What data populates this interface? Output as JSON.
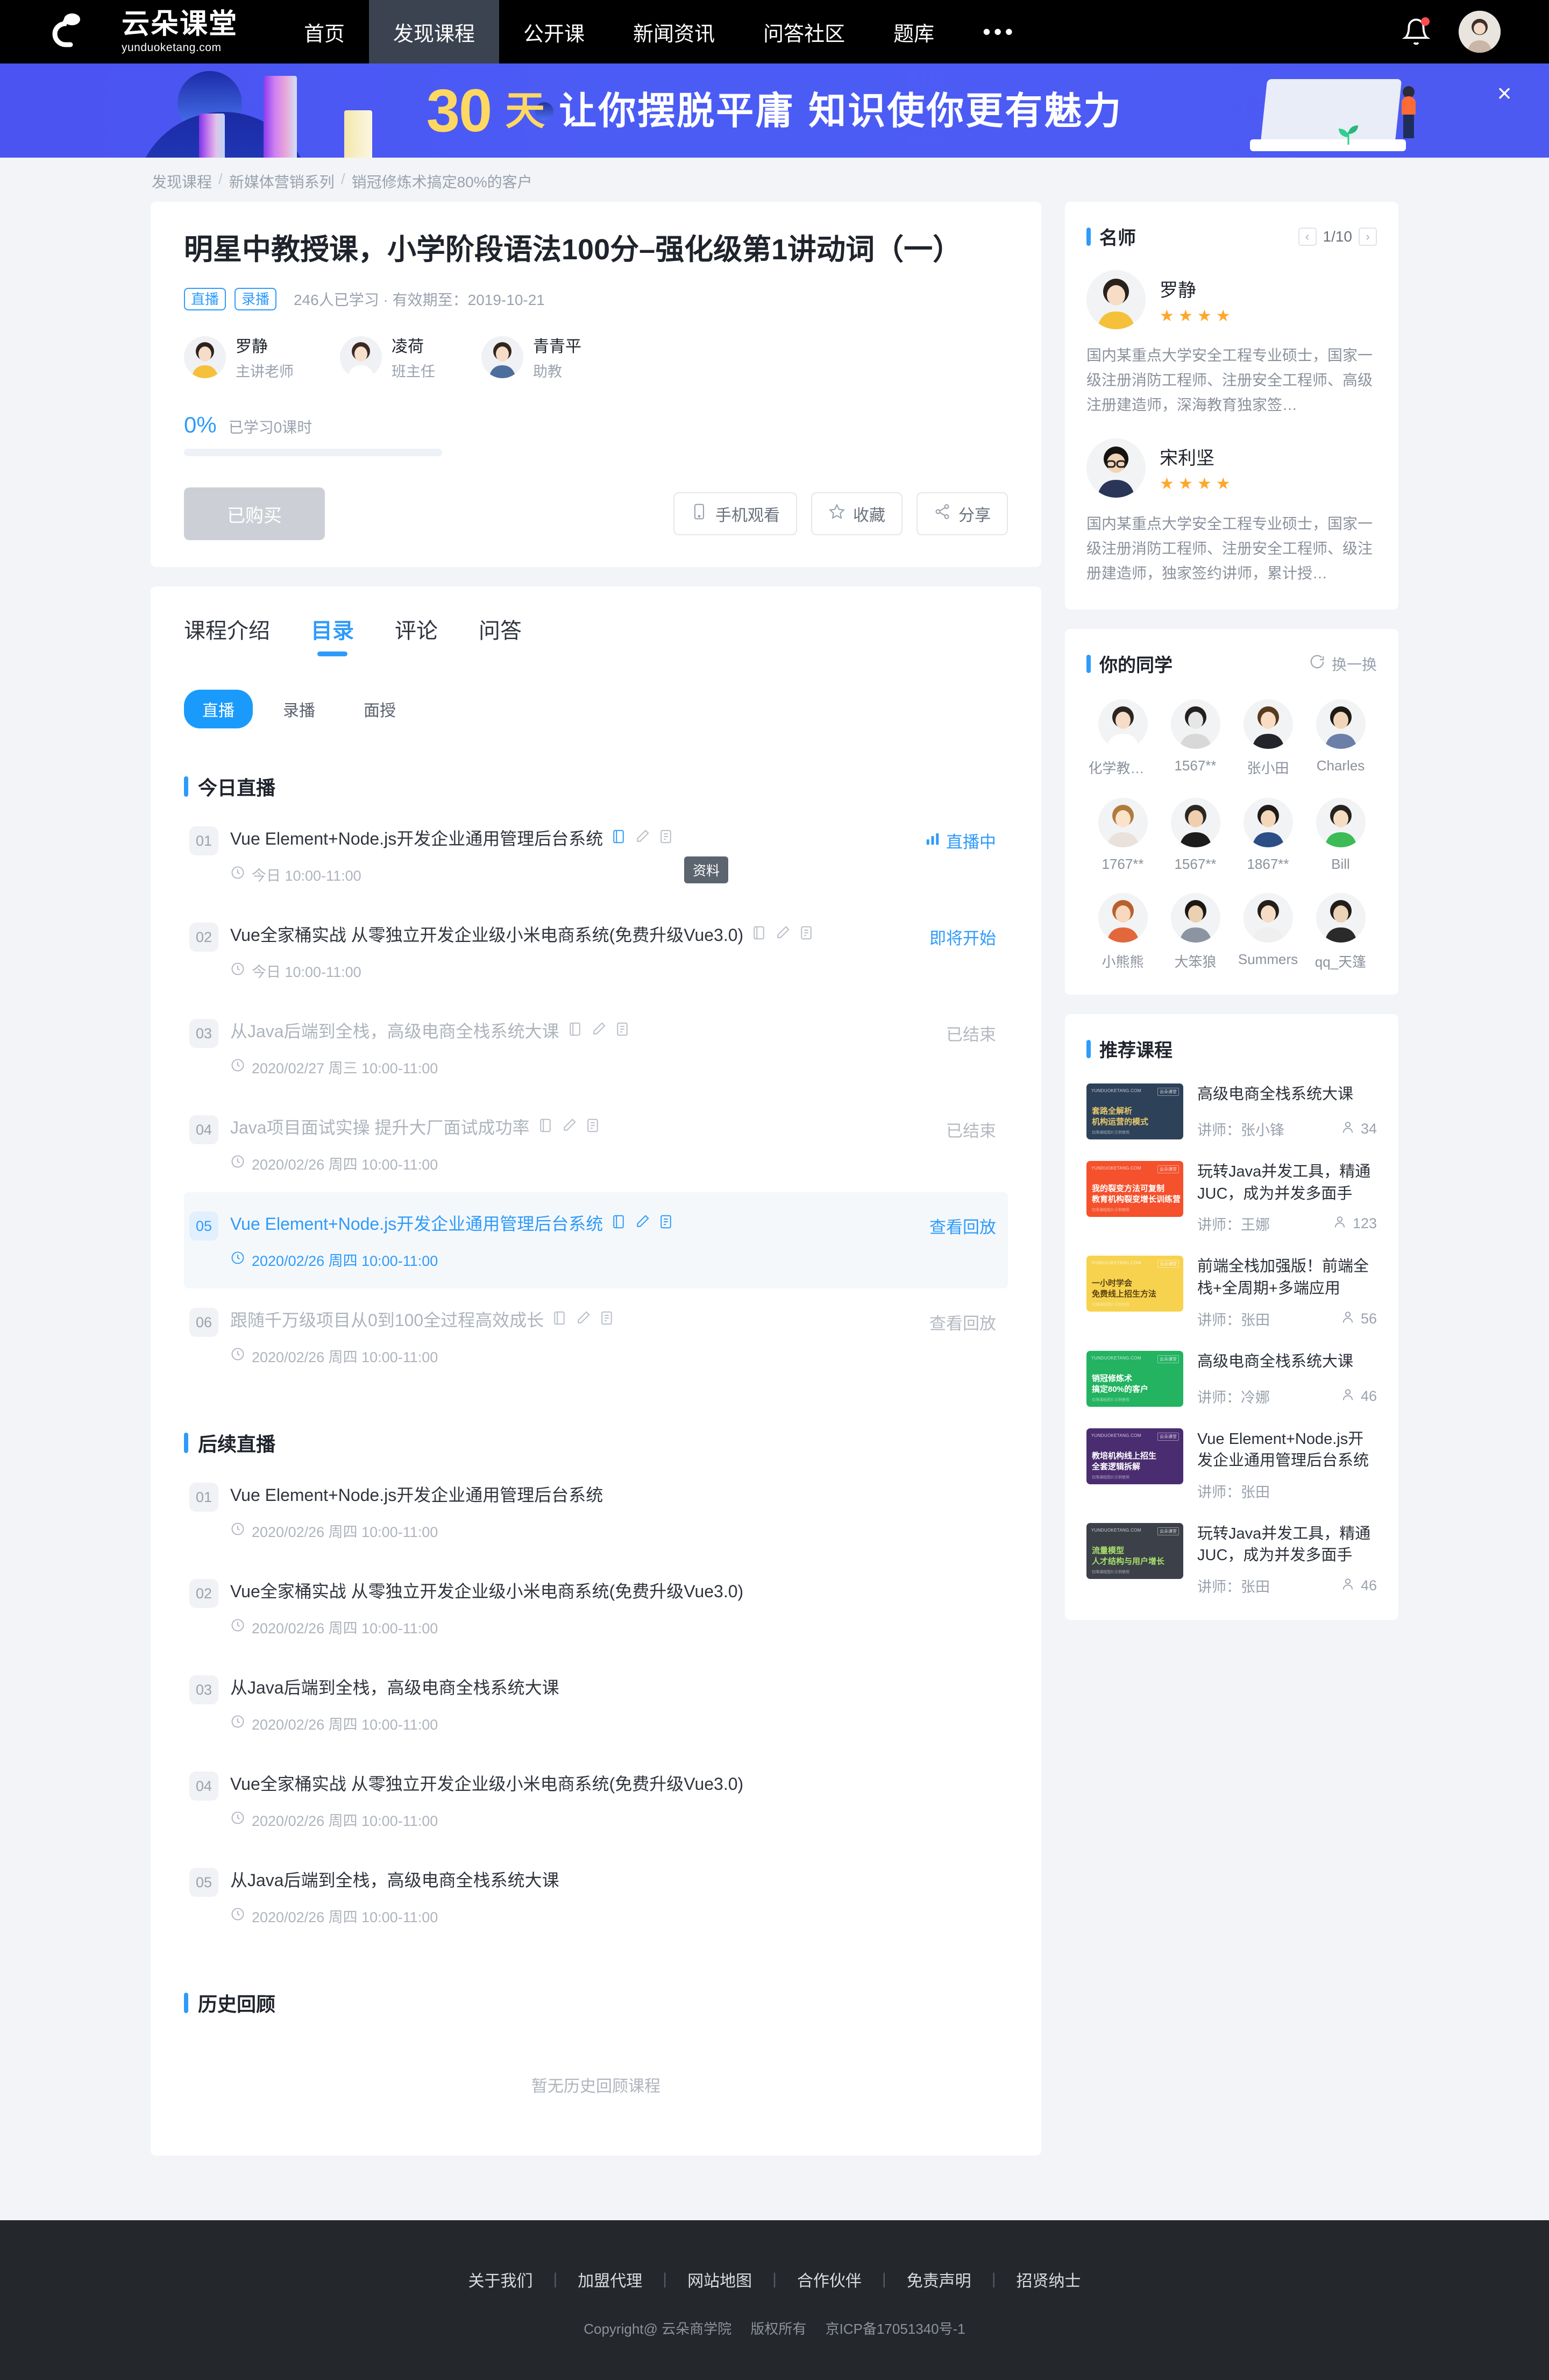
{
  "header": {
    "logo_cn": "云朵课堂",
    "logo_en": "yunduoketang.com",
    "nav": [
      {
        "label": "首页",
        "active": false
      },
      {
        "label": "发现课程",
        "active": true
      },
      {
        "label": "公开课",
        "active": false
      },
      {
        "label": "新闻资讯",
        "active": false
      },
      {
        "label": "问答社区",
        "active": false
      },
      {
        "label": "题库",
        "active": false
      }
    ],
    "more": "•••"
  },
  "banner": {
    "days": "30天",
    "days_num": "30",
    "days_unit": "天",
    "line1": "让你摆脱平庸",
    "line2": "知识使你更有魅力",
    "close": "×"
  },
  "breadcrumb": {
    "items": [
      "发现课程",
      "新媒体营销系列",
      "销冠修炼术搞定80%的客户"
    ],
    "separator": "/"
  },
  "course": {
    "title": "明星中教授课，小学阶段语法100分–强化级第1讲动词（一）",
    "tags": [
      "直播",
      "录播"
    ],
    "meta": "246人已学习 · 有效期至：2019-10-21",
    "teachers": [
      {
        "name": "罗静",
        "role": "主讲老师"
      },
      {
        "name": "凌荷",
        "role": "班主任"
      },
      {
        "name": "青青平",
        "role": "助教"
      }
    ],
    "progress_pct": "0%",
    "progress_label": "已学习0课时",
    "progress_value": 0,
    "buy_button": "已购买",
    "actions": [
      {
        "label": "手机观看",
        "icon": "phone-icon"
      },
      {
        "label": "收藏",
        "icon": "star-icon"
      },
      {
        "label": "分享",
        "icon": "share-icon"
      }
    ]
  },
  "tabs": [
    {
      "label": "课程介绍",
      "active": false
    },
    {
      "label": "目录",
      "active": true
    },
    {
      "label": "评论",
      "active": false
    },
    {
      "label": "问答",
      "active": false
    }
  ],
  "pills": [
    {
      "label": "直播",
      "active": true
    },
    {
      "label": "录播",
      "active": false
    },
    {
      "label": "面授",
      "active": false
    }
  ],
  "today_live": {
    "title": "今日直播",
    "tooltip": "资料",
    "lessons": [
      {
        "num": "01",
        "name": "Vue Element+Node.js开发企业通用管理后台系统",
        "time": "今日 10:00-11:00",
        "status": "直播中",
        "status_type": "live",
        "state": "normal",
        "icons": true
      },
      {
        "num": "02",
        "name": "Vue全家桶实战 从零独立开发企业级小米电商系统(免费升级Vue3.0)",
        "time": "今日 10:00-11:00",
        "status": "即将开始",
        "status_type": "soon",
        "state": "normal",
        "icons": true
      },
      {
        "num": "03",
        "name": "从Java后端到全栈，高级电商全栈系统大课",
        "time": "2020/02/27 周三 10:00-11:00",
        "status": "已结束",
        "status_type": "end",
        "state": "dim",
        "icons": true
      },
      {
        "num": "04",
        "name": "Java项目面试实操 提升大厂面试成功率",
        "time": "2020/02/26 周四 10:00-11:00",
        "status": "已结束",
        "status_type": "end",
        "state": "dim",
        "icons": true
      },
      {
        "num": "05",
        "name": "Vue Element+Node.js开发企业通用管理后台系统",
        "time": "2020/02/26 周四 10:00-11:00",
        "status": "查看回放",
        "status_type": "replay",
        "state": "hl",
        "icons": true
      },
      {
        "num": "06",
        "name": "跟随千万级项目从0到100全过程高效成长",
        "time": "2020/02/26 周四 10:00-11:00",
        "status": "查看回放",
        "status_type": "replay-dim",
        "state": "dim",
        "icons": true
      }
    ]
  },
  "upcoming_live": {
    "title": "后续直播",
    "lessons": [
      {
        "num": "01",
        "name": "Vue Element+Node.js开发企业通用管理后台系统",
        "time": "2020/02/26 周四 10:00-11:00"
      },
      {
        "num": "02",
        "name": "Vue全家桶实战 从零独立开发企业级小米电商系统(免费升级Vue3.0)",
        "time": "2020/02/26 周四 10:00-11:00"
      },
      {
        "num": "03",
        "name": "从Java后端到全栈，高级电商全栈系统大课",
        "time": "2020/02/26 周四 10:00-11:00"
      },
      {
        "num": "04",
        "name": "Vue全家桶实战 从零独立开发企业级小米电商系统(免费升级Vue3.0)",
        "time": "2020/02/26 周四 10:00-11:00"
      },
      {
        "num": "05",
        "name": "从Java后端到全栈，高级电商全栈系统大课",
        "time": "2020/02/26 周四 10:00-11:00"
      }
    ]
  },
  "history": {
    "title": "历史回顾",
    "empty": "暂无历史回顾课程"
  },
  "sidebar": {
    "famous_teachers": {
      "title": "名师",
      "page": "1/10",
      "prev": "‹",
      "next": "›",
      "items": [
        {
          "name": "罗静",
          "stars": 4,
          "desc": "国内某重点大学安全工程专业硕士，国家一级注册消防工程师、注册安全工程师、高级注册建造师，深海教育独家签…"
        },
        {
          "name": "宋利坚",
          "stars": 4,
          "desc": "国内某重点大学安全工程专业硕士，国家一级注册消防工程师、注册安全工程师、级注册建造师，独家签约讲师，累计授…"
        }
      ]
    },
    "classmates": {
      "title": "你的同学",
      "refresh": "换一换",
      "items": [
        {
          "name": "化学教书…"
        },
        {
          "name": "1567**"
        },
        {
          "name": "张小田"
        },
        {
          "name": "Charles"
        },
        {
          "name": "1767**"
        },
        {
          "name": "1567**"
        },
        {
          "name": "1867**"
        },
        {
          "name": "Bill"
        },
        {
          "name": "小熊熊"
        },
        {
          "name": "大笨狼"
        },
        {
          "name": "Summers"
        },
        {
          "name": "qq_天篷"
        }
      ]
    },
    "recommended": {
      "title": "推荐课程",
      "teacher_prefix": "讲师：",
      "items": [
        {
          "title": "高级电商全栈系统大课",
          "teacher": "讲师：张小锋",
          "count": "34",
          "thumb_color": "#2d4159",
          "thumb_accent": "#e8c86a",
          "thumb_l1": "套路全解析",
          "thumb_l2": "机构运营的模式",
          "thumb_brand": "YUNDUOKETANG.COM",
          "thumb_badge": "云朵课堂",
          "thumb_foot": "仅限课程图片示例使用"
        },
        {
          "title": "玩转Java并发工具，精通JUC，成为并发多面手",
          "teacher": "讲师：王娜",
          "count": "123",
          "thumb_color": "#f4512c",
          "thumb_accent": "#ffffff",
          "thumb_l1": "我的裂变方法可复制",
          "thumb_l2": "教育机构裂变增长训练营",
          "thumb_brand": "YUNDUOKETANG.COM",
          "thumb_badge": "云朵课堂",
          "thumb_foot": "仅限课程图片示例使用"
        },
        {
          "title": "前端全栈加强版！前端全栈+全周期+多端应用",
          "teacher": "讲师：张田",
          "count": "56",
          "thumb_color": "#f7d24e",
          "thumb_accent": "#5a4313",
          "thumb_l1": "一小时学会",
          "thumb_l2": "免费线上招生方法",
          "thumb_brand": "YUNDUOKETANG.COM",
          "thumb_badge": "云朵课堂",
          "thumb_foot": "仅限课程图片示例使用"
        },
        {
          "title": "高级电商全栈系统大课",
          "teacher": "讲师：冷娜",
          "count": "46",
          "thumb_color": "#23b361",
          "thumb_accent": "#ffffff",
          "thumb_l1": "销冠修炼术",
          "thumb_l2": "搞定80%的客户",
          "thumb_brand": "YUNDUOKETANG.COM",
          "thumb_badge": "云朵课堂",
          "thumb_foot": "仅限课程图片示例使用"
        },
        {
          "title": "Vue Element+Node.js开发企业通用管理后台系统",
          "teacher": "讲师：张田",
          "count": "",
          "thumb_color": "#4a2d70",
          "thumb_accent": "#ffffff",
          "thumb_l1": "教培机构线上招生",
          "thumb_l2": "全套逻辑拆解",
          "thumb_brand": "YUNDUOKETANG.COM",
          "thumb_badge": "云朵课堂",
          "thumb_foot": "仅限课程图片示例使用"
        },
        {
          "title": "玩转Java并发工具，精通JUC，成为并发多面手",
          "teacher": "讲师：张田",
          "count": "46",
          "thumb_color": "#3c4049",
          "thumb_accent": "#a8e06a",
          "thumb_l1": "流量模型",
          "thumb_l2": "人才结构与用户增长",
          "thumb_brand": "YUNDUOKETANG.COM",
          "thumb_badge": "云朵课堂",
          "thumb_foot": "仅限课程图片示例使用"
        }
      ]
    }
  },
  "footer": {
    "links": [
      "关于我们",
      "加盟代理",
      "网站地图",
      "合作伙伴",
      "免责声明",
      "招贤纳士"
    ],
    "divider": "|",
    "copyright": "Copyright@ 云朵商学院",
    "rights": "版权所有",
    "icp": "京ICP备17051340号-1"
  },
  "colors": {
    "accent": "#2e9bfb",
    "banner_bg": "#4b56f2",
    "banner_text": "#ffd862",
    "star": "#ffa629",
    "header_bg": "#000000",
    "footer_bg": "#24272c"
  }
}
